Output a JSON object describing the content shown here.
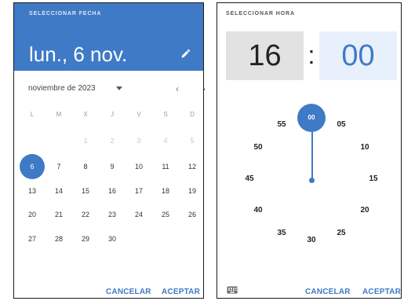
{
  "date_picker": {
    "caption": "SELECCIONAR FECHA",
    "headline": "lun., 6 nov.",
    "month_label": "noviembre de 2023",
    "nav_prev": "‹",
    "nav_next": "›",
    "weekdays": [
      "L",
      "M",
      "X",
      "J",
      "V",
      "S",
      "D"
    ],
    "weeks": [
      [
        "",
        "",
        "1",
        "2",
        "3",
        "4",
        "5"
      ],
      [
        "6",
        "7",
        "8",
        "9",
        "10",
        "11",
        "12"
      ],
      [
        "13",
        "14",
        "15",
        "16",
        "17",
        "18",
        "19"
      ],
      [
        "20",
        "21",
        "22",
        "23",
        "24",
        "25",
        "26"
      ],
      [
        "27",
        "28",
        "29",
        "30",
        "",
        "",
        ""
      ]
    ],
    "selected_day": "6",
    "cancel_label": "CANCELAR",
    "accept_label": "ACEPTAR",
    "accent_color": "#3f7ac6",
    "icons": {
      "edit": "pencil-icon",
      "month_dropdown": "caret-down-icon"
    }
  },
  "time_picker": {
    "caption": "SELECCIONAR HORA",
    "hour": "16",
    "separator": ":",
    "minute": "00",
    "clock_labels": [
      "00",
      "05",
      "10",
      "15",
      "20",
      "25",
      "30",
      "35",
      "40",
      "45",
      "50",
      "55"
    ],
    "selected_minute": "00",
    "cancel_label": "CANCELAR",
    "accept_label": "ACEPTAR",
    "icons": {
      "input_mode": "keyboard-icon"
    }
  }
}
